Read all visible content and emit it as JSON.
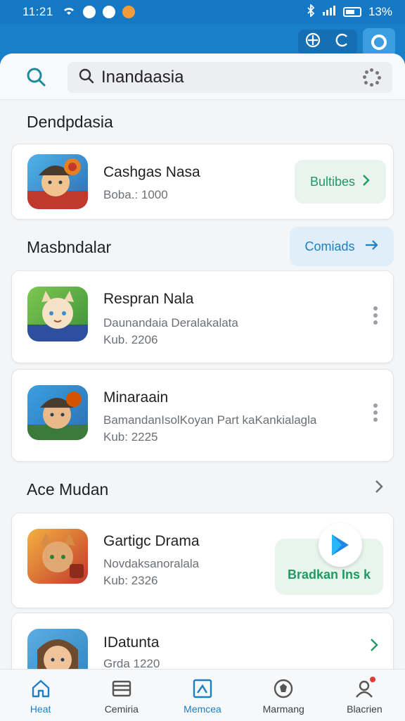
{
  "status_bar": {
    "time": "11:21",
    "battery": "13%"
  },
  "search": {
    "query": "Inandaasia"
  },
  "sections": {
    "first_title": "Dendpdasia",
    "second_title": "Masbndalar",
    "second_action": "Comiads",
    "third_title": "Ace Mudan"
  },
  "apps": [
    {
      "name": "Cashgas Nasa",
      "line1": "Boba.: 1000",
      "line2": "",
      "action": "Bultibes"
    },
    {
      "name": "Respran Nala",
      "line1": "Daunandaia Deralakalata",
      "line2": "Kub. 2206"
    },
    {
      "name": "Minaraain",
      "line1": "BamandanIsolKoyan Part kaKankialagla",
      "line2": "Kub: 2225"
    },
    {
      "name": "Gartigc Drama",
      "line1": "Novdaksanoralala",
      "line2": "Kub: 2326",
      "action": "Bradkan Ins k"
    },
    {
      "name": "IDatunta",
      "line1": "Grda 1220",
      "line2": ""
    }
  ],
  "nav": [
    {
      "label": "Heat",
      "icon": "home-icon"
    },
    {
      "label": "Cemiria",
      "icon": "list-icon"
    },
    {
      "label": "Memcea",
      "icon": "chart-icon"
    },
    {
      "label": "Marmang",
      "icon": "badge-icon"
    },
    {
      "label": "Blacrien",
      "icon": "profile-icon"
    }
  ],
  "colors": {
    "accent": "#1c80c6",
    "green": "#1f9a62",
    "header": "#1a7fc9"
  }
}
